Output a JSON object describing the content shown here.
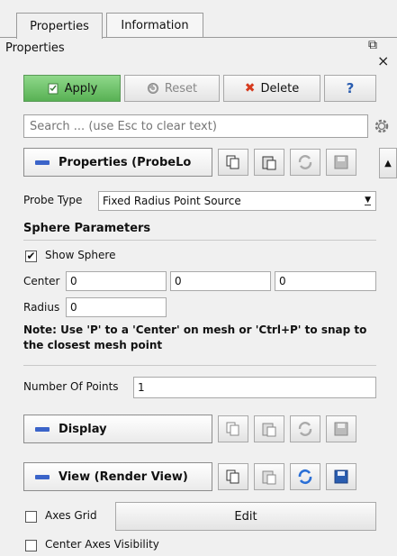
{
  "tabs": [
    {
      "label": "Properties"
    },
    {
      "label": "Information"
    }
  ],
  "panel": {
    "title": "Properties",
    "float_glyph": "⧉",
    "close_glyph": "×"
  },
  "toolbar": {
    "apply_label": "Apply",
    "reset_label": "Reset",
    "delete_label": "Delete",
    "help_label": "?"
  },
  "search": {
    "placeholder": "Search ... (use Esc to clear text)"
  },
  "sections": {
    "properties": {
      "label": "Properties (ProbeLo"
    },
    "display": {
      "label": "Display"
    },
    "view": {
      "label": "View (Render View)"
    }
  },
  "probe": {
    "type_label": "Probe Type",
    "type_value": "Fixed Radius Point Source",
    "sphere_header": "Sphere Parameters",
    "show_sphere_label": "Show Sphere",
    "show_sphere_checked": true,
    "center_label": "Center",
    "center_values": [
      "0",
      "0",
      "0"
    ],
    "radius_label": "Radius",
    "radius_value": "0",
    "note": "Note: Use 'P' to a 'Center' on mesh or 'Ctrl+P' to snap to the closest mesh point",
    "num_points_label": "Number Of Points",
    "num_points_value": "1"
  },
  "view_options": {
    "axes_grid_label": "Axes Grid",
    "axes_grid_checked": false,
    "edit_label": "Edit",
    "center_axes_label": "Center Axes Visibility",
    "center_axes_checked": false
  },
  "colors": {
    "apply_green": "#58b154",
    "section_blue": "#3b64c9",
    "delete_red": "#d63b1f",
    "help_blue": "#2a5db0"
  }
}
